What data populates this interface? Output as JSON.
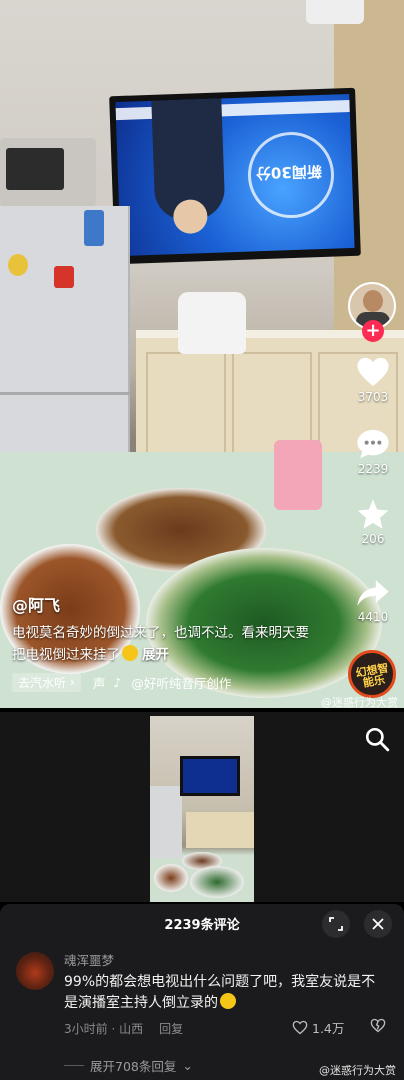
{
  "video": {
    "author": "@阿飞",
    "caption": "电视莫名奇妙的倒过来了，也调不过。看来明天要把电视倒过来挂了",
    "expand_label": "展开",
    "tag_label": "去汽水听",
    "music_prefix": "声",
    "music_credit": "@好听纯音厅创作",
    "tv_logo_text": "新闻30分",
    "music_badge_text": "幻想智能乐",
    "watermark": "@迷惑行为大赏"
  },
  "actions": {
    "likes": "3703",
    "comments": "2239",
    "favorites": "206",
    "shares": "4410"
  },
  "comments_panel": {
    "title": "2239条评论",
    "comment": {
      "username": "魂浑噩梦",
      "text": "99%的都会想电视出什么问题了吧，我室友说是不是演播室主持人倒立录的",
      "time_location": "3小时前 · 山西",
      "reply_label": "回复",
      "like_count": "1.4万"
    },
    "expand_replies": "展开708条回复",
    "watermark": "@迷惑行为大赏"
  },
  "colors": {
    "accent": "#fe2c55",
    "panel_bg": "#1b1b1d"
  }
}
